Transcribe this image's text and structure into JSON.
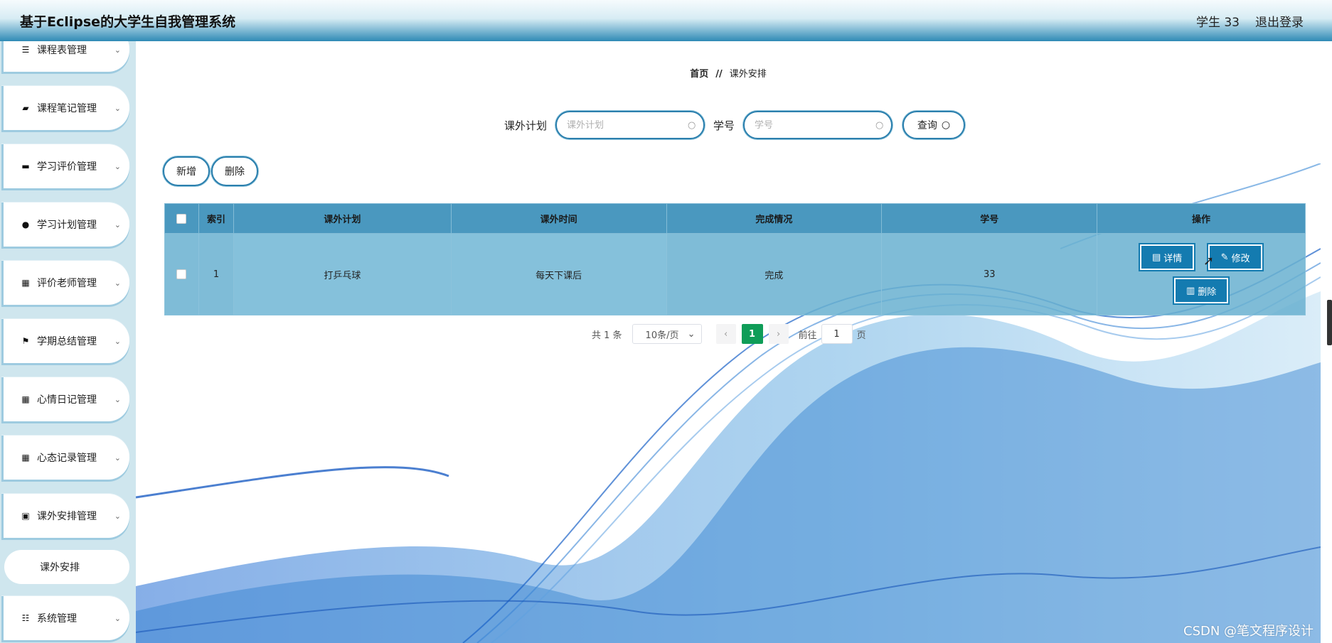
{
  "header": {
    "title": "基于Eclipse的大学生自我管理系统",
    "user": "学生 33",
    "logout": "退出登录"
  },
  "sidebar": {
    "items": [
      {
        "label": "课程表管理",
        "icon": "list-icon"
      },
      {
        "label": "课程笔记管理",
        "icon": "briefcase-icon"
      },
      {
        "label": "学习评价管理",
        "icon": "monitor-icon"
      },
      {
        "label": "学习计划管理",
        "icon": "user-icon"
      },
      {
        "label": "评价老师管理",
        "icon": "grid-icon"
      },
      {
        "label": "学期总结管理",
        "icon": "flag-icon"
      },
      {
        "label": "心情日记管理",
        "icon": "grid-icon"
      },
      {
        "label": "心态记录管理",
        "icon": "grid-icon"
      },
      {
        "label": "课外安排管理",
        "icon": "bus-icon"
      },
      {
        "label": "系统管理",
        "icon": "sliders-icon"
      }
    ],
    "active_sub": "课外安排"
  },
  "breadcrumb": {
    "home": "首页",
    "separator": "//",
    "current": "课外安排"
  },
  "search": {
    "plan_label": "课外计划",
    "plan_placeholder": "课外计划",
    "id_label": "学号",
    "id_placeholder": "学号",
    "query_button": "查询"
  },
  "actions": {
    "add": "新增",
    "delete": "删除"
  },
  "table": {
    "headers": [
      "索引",
      "课外计划",
      "课外时间",
      "完成情况",
      "学号",
      "操作"
    ],
    "rows": [
      {
        "index": "1",
        "plan": "打乒乓球",
        "time": "每天下课后",
        "status": "完成",
        "student_id": "33"
      }
    ],
    "ops": {
      "detail": "详情",
      "edit": "修改",
      "delete": "删除"
    }
  },
  "pagination": {
    "total": "共 1 条",
    "page_size": "10条/页",
    "current_page": "1",
    "goto_label": "前往",
    "goto_value": "1",
    "page_suffix": "页"
  },
  "watermark": "CSDN @笔文程序设计",
  "colors": {
    "accent": "#147bb0",
    "header_bottom": "#2f8ab5",
    "table_header": "#4a98bf",
    "page_active": "#0f9d58",
    "sidebar_bg": "#cfe6ee"
  }
}
